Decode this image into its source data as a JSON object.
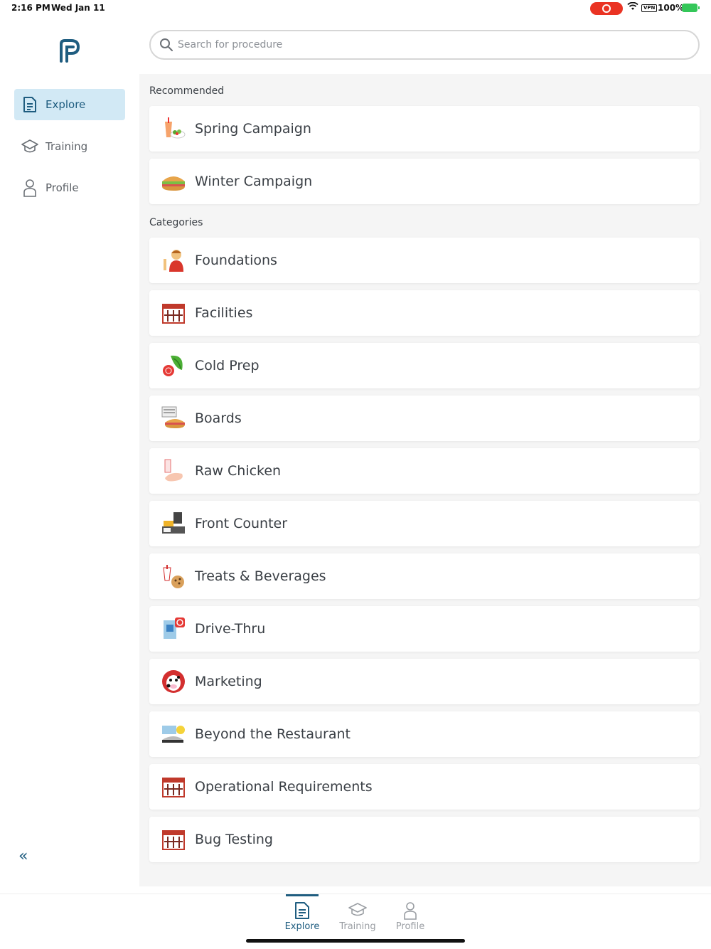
{
  "status_bar": {
    "time": "2:16 PM",
    "date": "Wed Jan 11",
    "vpn": "VPN",
    "battery": "100%"
  },
  "sidebar": {
    "logo_icon": "brand-logo",
    "items": [
      {
        "label": "Explore",
        "icon": "document-icon",
        "active": true
      },
      {
        "label": "Training",
        "icon": "graduation-cap-icon",
        "active": false
      },
      {
        "label": "Profile",
        "icon": "person-icon",
        "active": false
      }
    ],
    "collapse_icon": "«"
  },
  "search": {
    "placeholder": "Search for procedure",
    "value": ""
  },
  "recommended": {
    "title": "Recommended",
    "items": [
      {
        "label": "Spring Campaign",
        "icon": "drink-salad-icon"
      },
      {
        "label": "Winter Campaign",
        "icon": "sandwich-icon"
      }
    ]
  },
  "categories": {
    "title": "Categories",
    "items": [
      {
        "label": "Foundations",
        "icon": "team-member-icon"
      },
      {
        "label": "Facilities",
        "icon": "restaurant-building-icon"
      },
      {
        "label": "Cold Prep",
        "icon": "lettuce-tomato-icon"
      },
      {
        "label": "Boards",
        "icon": "menu-board-icon"
      },
      {
        "label": "Raw Chicken",
        "icon": "raw-chicken-icon"
      },
      {
        "label": "Front Counter",
        "icon": "register-icon"
      },
      {
        "label": "Treats & Beverages",
        "icon": "cookie-drink-icon"
      },
      {
        "label": "Drive-Thru",
        "icon": "drive-thru-icon"
      },
      {
        "label": "Marketing",
        "icon": "cow-icon"
      },
      {
        "label": "Beyond the Restaurant",
        "icon": "catering-icon"
      },
      {
        "label": "Operational Requirements",
        "icon": "restaurant-building-icon"
      },
      {
        "label": "Bug Testing",
        "icon": "restaurant-building-icon"
      }
    ]
  },
  "tabbar": {
    "tabs": [
      {
        "label": "Explore",
        "icon": "document-icon",
        "active": true
      },
      {
        "label": "Training",
        "icon": "graduation-cap-icon",
        "active": false
      },
      {
        "label": "Profile",
        "icon": "person-icon",
        "active": false
      }
    ]
  },
  "colors": {
    "accent": "#1f5d80",
    "active_bg": "#d2e9f5",
    "recording": "#ea3323",
    "battery": "#34c759"
  }
}
